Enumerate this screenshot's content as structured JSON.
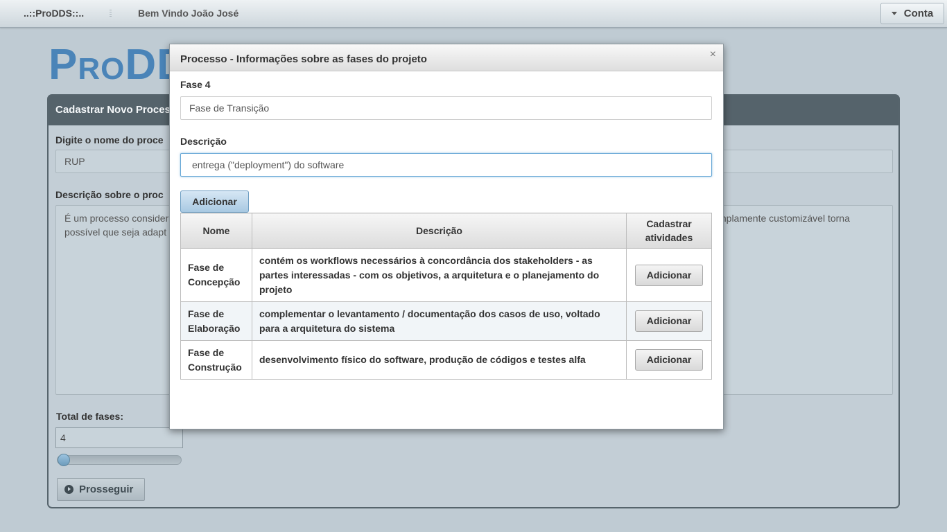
{
  "topbar": {
    "brand": "..::ProDDS::..",
    "welcome": "Bem Vindo João José",
    "account_label": "Conta"
  },
  "background": {
    "logo_big_1": "P",
    "logo_small": "RO",
    "logo_big_2": "DD",
    "panel_title": "Cadastrar Novo Proces",
    "name_label": "Digite o nome do proce",
    "name_value": "RUP",
    "desc_label": "Descrição sobre o proc",
    "desc_left_line1": "É um processo consider",
    "desc_left_line2": "possível que seja adapt",
    "desc_right_line1": "mplamente customizável torna",
    "total_label": "Total de fases:",
    "total_value": "4",
    "slider_value": 0,
    "proceed_label": "Prosseguir"
  },
  "modal": {
    "title": "Processo - Informações sobre as fases do projeto",
    "close_glyph": "×",
    "phase_label": "Fase 4",
    "phase_value": "Fase de Transição",
    "desc_label": "Descrição",
    "desc_value": "entrega (\"deployment\") do software",
    "add_label": "Adicionar",
    "table": {
      "headers": [
        "Nome",
        "Descrição",
        "Cadastrar atividades"
      ],
      "rows": [
        {
          "name": "Fase de Concepção",
          "description": "contém os workflows necessários à concordância dos stakeholders - as partes interessadas - com os objetivos, a arquitetura e o planejamento do projeto",
          "action": "Adicionar"
        },
        {
          "name": "Fase de Elaboração",
          "description": "complementar o levantamento / documentação dos casos de uso, voltado para a arquitetura do sistema",
          "action": "Adicionar"
        },
        {
          "name": "Fase de Construção",
          "description": "desenvolvimento físico do software, produção de códigos e testes alfa",
          "action": "Adicionar"
        }
      ]
    }
  }
}
